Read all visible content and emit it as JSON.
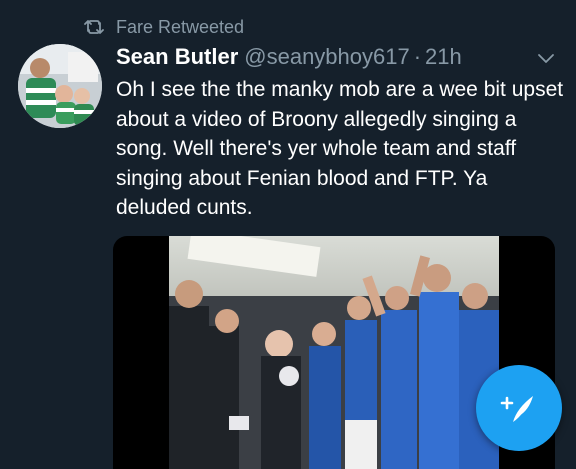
{
  "retweet": {
    "icon": "retweet-icon",
    "label": "Fare Retweeted"
  },
  "tweet": {
    "author_name": "Sean Butler",
    "handle": "@seanybhoy617",
    "separator": "·",
    "time": "21h",
    "text": "Oh I see the the manky mob are a wee bit upset about a video of Broony allegedly singing a song. Well there's yer whole team and staff singing about Fenian blood and FTP. Ya deluded cunts.",
    "menu_icon": "chevron-down-icon",
    "media_type": "video"
  },
  "compose": {
    "icon": "compose-tweet-icon",
    "color": "#1da1f2"
  },
  "colors": {
    "background": "#15202b",
    "secondary_text": "#8899a6",
    "primary_text": "#ffffff",
    "accent": "#1da1f2"
  }
}
